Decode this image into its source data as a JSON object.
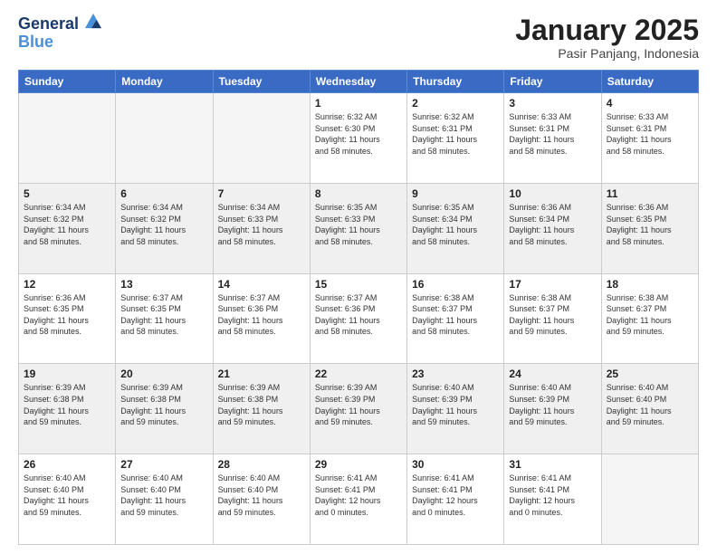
{
  "header": {
    "logo_line1": "General",
    "logo_line2": "Blue",
    "month_title": "January 2025",
    "location": "Pasir Panjang, Indonesia"
  },
  "weekdays": [
    "Sunday",
    "Monday",
    "Tuesday",
    "Wednesday",
    "Thursday",
    "Friday",
    "Saturday"
  ],
  "days": [
    {
      "num": "",
      "info": ""
    },
    {
      "num": "",
      "info": ""
    },
    {
      "num": "",
      "info": ""
    },
    {
      "num": "1",
      "info": "Sunrise: 6:32 AM\nSunset: 6:30 PM\nDaylight: 11 hours\nand 58 minutes."
    },
    {
      "num": "2",
      "info": "Sunrise: 6:32 AM\nSunset: 6:31 PM\nDaylight: 11 hours\nand 58 minutes."
    },
    {
      "num": "3",
      "info": "Sunrise: 6:33 AM\nSunset: 6:31 PM\nDaylight: 11 hours\nand 58 minutes."
    },
    {
      "num": "4",
      "info": "Sunrise: 6:33 AM\nSunset: 6:31 PM\nDaylight: 11 hours\nand 58 minutes."
    },
    {
      "num": "5",
      "info": "Sunrise: 6:34 AM\nSunset: 6:32 PM\nDaylight: 11 hours\nand 58 minutes."
    },
    {
      "num": "6",
      "info": "Sunrise: 6:34 AM\nSunset: 6:32 PM\nDaylight: 11 hours\nand 58 minutes."
    },
    {
      "num": "7",
      "info": "Sunrise: 6:34 AM\nSunset: 6:33 PM\nDaylight: 11 hours\nand 58 minutes."
    },
    {
      "num": "8",
      "info": "Sunrise: 6:35 AM\nSunset: 6:33 PM\nDaylight: 11 hours\nand 58 minutes."
    },
    {
      "num": "9",
      "info": "Sunrise: 6:35 AM\nSunset: 6:34 PM\nDaylight: 11 hours\nand 58 minutes."
    },
    {
      "num": "10",
      "info": "Sunrise: 6:36 AM\nSunset: 6:34 PM\nDaylight: 11 hours\nand 58 minutes."
    },
    {
      "num": "11",
      "info": "Sunrise: 6:36 AM\nSunset: 6:35 PM\nDaylight: 11 hours\nand 58 minutes."
    },
    {
      "num": "12",
      "info": "Sunrise: 6:36 AM\nSunset: 6:35 PM\nDaylight: 11 hours\nand 58 minutes."
    },
    {
      "num": "13",
      "info": "Sunrise: 6:37 AM\nSunset: 6:35 PM\nDaylight: 11 hours\nand 58 minutes."
    },
    {
      "num": "14",
      "info": "Sunrise: 6:37 AM\nSunset: 6:36 PM\nDaylight: 11 hours\nand 58 minutes."
    },
    {
      "num": "15",
      "info": "Sunrise: 6:37 AM\nSunset: 6:36 PM\nDaylight: 11 hours\nand 58 minutes."
    },
    {
      "num": "16",
      "info": "Sunrise: 6:38 AM\nSunset: 6:37 PM\nDaylight: 11 hours\nand 58 minutes."
    },
    {
      "num": "17",
      "info": "Sunrise: 6:38 AM\nSunset: 6:37 PM\nDaylight: 11 hours\nand 59 minutes."
    },
    {
      "num": "18",
      "info": "Sunrise: 6:38 AM\nSunset: 6:37 PM\nDaylight: 11 hours\nand 59 minutes."
    },
    {
      "num": "19",
      "info": "Sunrise: 6:39 AM\nSunset: 6:38 PM\nDaylight: 11 hours\nand 59 minutes."
    },
    {
      "num": "20",
      "info": "Sunrise: 6:39 AM\nSunset: 6:38 PM\nDaylight: 11 hours\nand 59 minutes."
    },
    {
      "num": "21",
      "info": "Sunrise: 6:39 AM\nSunset: 6:38 PM\nDaylight: 11 hours\nand 59 minutes."
    },
    {
      "num": "22",
      "info": "Sunrise: 6:39 AM\nSunset: 6:39 PM\nDaylight: 11 hours\nand 59 minutes."
    },
    {
      "num": "23",
      "info": "Sunrise: 6:40 AM\nSunset: 6:39 PM\nDaylight: 11 hours\nand 59 minutes."
    },
    {
      "num": "24",
      "info": "Sunrise: 6:40 AM\nSunset: 6:39 PM\nDaylight: 11 hours\nand 59 minutes."
    },
    {
      "num": "25",
      "info": "Sunrise: 6:40 AM\nSunset: 6:40 PM\nDaylight: 11 hours\nand 59 minutes."
    },
    {
      "num": "26",
      "info": "Sunrise: 6:40 AM\nSunset: 6:40 PM\nDaylight: 11 hours\nand 59 minutes."
    },
    {
      "num": "27",
      "info": "Sunrise: 6:40 AM\nSunset: 6:40 PM\nDaylight: 11 hours\nand 59 minutes."
    },
    {
      "num": "28",
      "info": "Sunrise: 6:40 AM\nSunset: 6:40 PM\nDaylight: 11 hours\nand 59 minutes."
    },
    {
      "num": "29",
      "info": "Sunrise: 6:41 AM\nSunset: 6:41 PM\nDaylight: 12 hours\nand 0 minutes."
    },
    {
      "num": "30",
      "info": "Sunrise: 6:41 AM\nSunset: 6:41 PM\nDaylight: 12 hours\nand 0 minutes."
    },
    {
      "num": "31",
      "info": "Sunrise: 6:41 AM\nSunset: 6:41 PM\nDaylight: 12 hours\nand 0 minutes."
    },
    {
      "num": "",
      "info": ""
    },
    {
      "num": "",
      "info": ""
    }
  ]
}
